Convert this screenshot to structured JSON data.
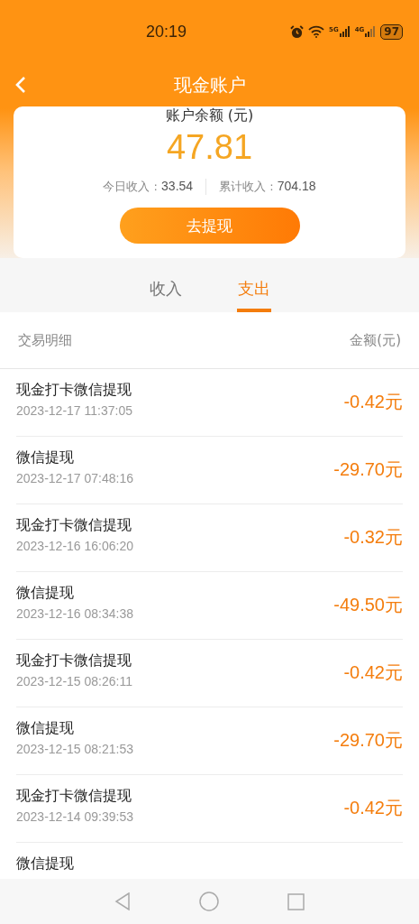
{
  "status_bar": {
    "time": "20:19",
    "network_1": "5G",
    "network_2": "4G",
    "battery": "97"
  },
  "header": {
    "title": "现金账户"
  },
  "balance_card": {
    "label": "账户余额 (元)",
    "amount": "47.81",
    "today_label": "今日收入 : ",
    "today_value": "33.54",
    "total_label": "累计收入 : ",
    "total_value": "704.18",
    "button": "去提现"
  },
  "tabs": [
    {
      "label": "收入",
      "selected": false
    },
    {
      "label": "支出",
      "selected": true
    }
  ],
  "list_header": {
    "left": "交易明细",
    "right": "金额(元)"
  },
  "transactions": [
    {
      "title": "现金打卡微信提现",
      "time": "2023-12-17 11:37:05",
      "amount": "-0.42元"
    },
    {
      "title": "微信提现",
      "time": "2023-12-17 07:48:16",
      "amount": "-29.70元"
    },
    {
      "title": "现金打卡微信提现",
      "time": "2023-12-16 16:06:20",
      "amount": "-0.32元"
    },
    {
      "title": "微信提现",
      "time": "2023-12-16 08:34:38",
      "amount": "-49.50元"
    },
    {
      "title": "现金打卡微信提现",
      "time": "2023-12-15 08:26:11",
      "amount": "-0.42元"
    },
    {
      "title": "微信提现",
      "time": "2023-12-15 08:21:53",
      "amount": "-29.70元"
    },
    {
      "title": "现金打卡微信提现",
      "time": "2023-12-14 09:39:53",
      "amount": "-0.42元"
    },
    {
      "title": "微信提现"
    }
  ]
}
